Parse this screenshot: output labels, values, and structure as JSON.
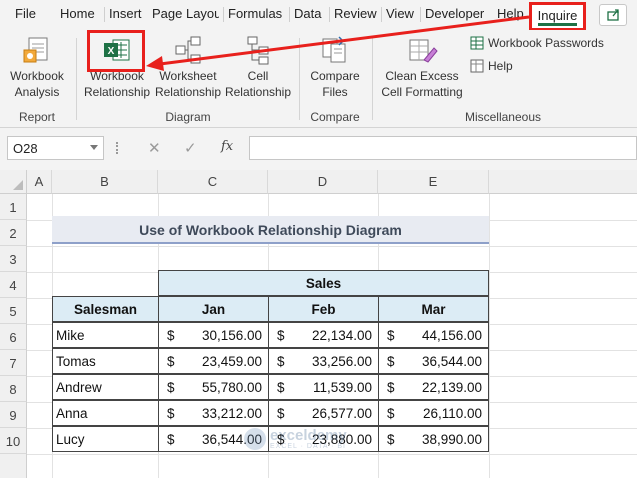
{
  "menu": {
    "tabs": [
      "File",
      "Home",
      "Insert",
      "Page Layout",
      "Formulas",
      "Data",
      "Review",
      "View",
      "Developer",
      "Help"
    ],
    "active_tab": "Inquire"
  },
  "ribbon": {
    "workbook_analysis": [
      "Workbook",
      "Analysis"
    ],
    "workbook_relationship": [
      "Workbook",
      "Relationship"
    ],
    "worksheet_relationship": [
      "Worksheet",
      "Relationship"
    ],
    "cell_relationship": [
      "Cell",
      "Relationship"
    ],
    "compare_files": [
      "Compare",
      "Files"
    ],
    "clean_excess": [
      "Clean Excess",
      "Cell Formatting"
    ],
    "workbook_passwords": "Workbook Passwords",
    "help": "Help",
    "groups": {
      "report": "Report",
      "diagram": "Diagram",
      "compare": "Compare",
      "misc": "Miscellaneous"
    }
  },
  "formula_bar": {
    "name_box": "O28",
    "cancel_icon": "✕",
    "enter_icon": "✓",
    "fx": "fx",
    "value": ""
  },
  "columns": [
    "A",
    "B",
    "C",
    "D",
    "E"
  ],
  "rows": [
    "1",
    "2",
    "3",
    "4",
    "5",
    "6",
    "7",
    "8",
    "9",
    "10"
  ],
  "sheet": {
    "title": "Use of Workbook Relationship Diagram",
    "group_header": "Sales",
    "headers": [
      "Salesman",
      "Jan",
      "Feb",
      "Mar"
    ],
    "currency": "$",
    "data": [
      {
        "name": "Mike",
        "jan": "30,156.00",
        "feb": "22,134.00",
        "mar": "44,156.00"
      },
      {
        "name": "Tomas",
        "jan": "23,459.00",
        "feb": "33,256.00",
        "mar": "36,544.00"
      },
      {
        "name": "Andrew",
        "jan": "55,780.00",
        "feb": "11,539.00",
        "mar": "22,139.00"
      },
      {
        "name": "Anna",
        "jan": "33,212.00",
        "feb": "26,577.00",
        "mar": "26,110.00"
      },
      {
        "name": "Lucy",
        "jan": "36,544.00",
        "feb": "23,880.00",
        "mar": "38,990.00"
      }
    ]
  },
  "watermark": {
    "name": "exceldemy",
    "sub": "EXCEL · DATA · BI"
  },
  "colors": {
    "highlight": "#e8201c",
    "header_fill": "#dcecf5",
    "title_fill": "#e8ebf2",
    "excel_green": "#1e7145"
  }
}
